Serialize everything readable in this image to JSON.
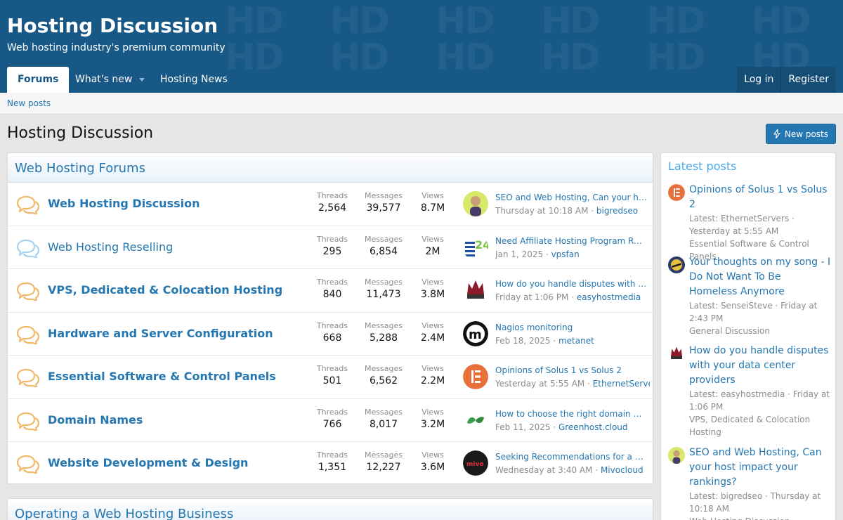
{
  "header": {
    "title": "Hosting Discussion",
    "tagline": "Web hosting industry's premium community",
    "watermark": "HD",
    "tabs": [
      {
        "label": "Forums"
      },
      {
        "label": "What's new"
      },
      {
        "label": "Hosting News"
      }
    ],
    "login": "Log in",
    "register": "Register"
  },
  "subnav": {
    "new_posts": "New posts"
  },
  "page": {
    "title": "Hosting Discussion",
    "new_posts_button": "New posts"
  },
  "forums_block": {
    "title": "Web Hosting Forums",
    "stat_labels": {
      "threads": "Threads",
      "messages": "Messages",
      "views": "Views"
    },
    "nodes": [
      {
        "title": "Web Hosting Discussion",
        "threads": "2,564",
        "messages": "39,577",
        "views": "8.7M",
        "last_title": "SEO and Web Hosting, Can your host impact your rankings?",
        "last_date": "Thursday at 10:18 AM",
        "last_user": "bigredseo",
        "avatar": "photo"
      },
      {
        "title": "Web Hosting Reselling",
        "threads": "295",
        "messages": "6,854",
        "views": "2M",
        "last_title": "Need Affiliate Hosting Program Recommendations",
        "last_date": "Jan 1, 2025",
        "last_user": "vpsfan",
        "avatar": "24-logo"
      },
      {
        "title": "VPS, Dedicated & Colocation Hosting",
        "threads": "840",
        "messages": "11,473",
        "views": "3.8M",
        "last_title": "How do you handle disputes with your data center providers",
        "last_date": "Friday at 1:06 PM",
        "last_user": "easyhostmedia",
        "avatar": "crown-logo"
      },
      {
        "title": "Hardware and Server Configuration",
        "threads": "668",
        "messages": "5,288",
        "views": "2.4M",
        "last_title": "Nagios monitoring",
        "last_date": "Feb 18, 2025",
        "last_user": "metanet",
        "avatar": "m-logo"
      },
      {
        "title": "Essential Software & Control Panels",
        "threads": "501",
        "messages": "6,562",
        "views": "2.2M",
        "last_title": "Opinions of Solus 1 vs Solus 2",
        "last_date": "Yesterday at 5:55 AM",
        "last_user": "EthernetServers",
        "avatar": "e-logo"
      },
      {
        "title": "Domain Names",
        "threads": "766",
        "messages": "8,017",
        "views": "3.2M",
        "last_title": "How to choose the right domain name",
        "last_date": "Feb 11, 2025",
        "last_user": "Greenhost.cloud",
        "avatar": "leaf-logo"
      },
      {
        "title": "Website Development & Design",
        "threads": "1,351",
        "messages": "12,227",
        "views": "3.6M",
        "last_title": "Seeking Recommendations for a Design Agency",
        "last_date": "Wednesday at 3:40 AM",
        "last_user": "Mivocloud",
        "avatar": "mivo-logo"
      }
    ]
  },
  "second_block": {
    "title": "Operating a Web Hosting Business"
  },
  "sidebar": {
    "title": "Latest posts",
    "items": [
      {
        "title": "Opinions of Solus 1 vs Solus 2",
        "meta": "Latest: EthernetServers · Yesterday at 5:55 AM",
        "forum": "Essential Software & Control Panels",
        "avatar": "e-logo"
      },
      {
        "title": "Your thoughts on my song - I Do Not Want To Be Homeless Anymore",
        "meta": "Latest: SenseiSteve · Friday at 2:43 PM",
        "forum": "General Discussion",
        "avatar": "steve"
      },
      {
        "title": "How do you handle disputes with your data center providers",
        "meta": "Latest: easyhostmedia · Friday at 1:06 PM",
        "forum": "VPS, Dedicated & Colocation Hosting",
        "avatar": "crown-logo"
      },
      {
        "title": "SEO and Web Hosting, Can your host impact your rankings?",
        "meta": "Latest: bigredseo · Thursday at 10:18 AM",
        "forum": "Web Hosting Discussion",
        "avatar": "photo"
      }
    ]
  },
  "colors": {
    "header_bg": "#185886",
    "link": "#2577b1",
    "accent_light": "#47a7eb",
    "muted": "#8c8c8c"
  }
}
